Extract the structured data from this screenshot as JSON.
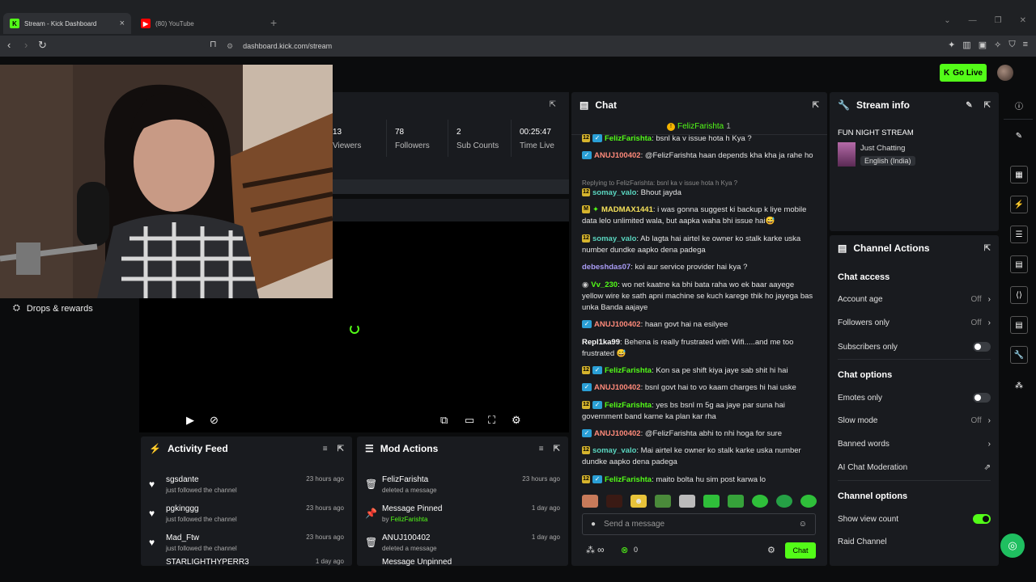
{
  "browser": {
    "tabs": [
      {
        "label": "Stream - Kick Dashboard",
        "active": true
      },
      {
        "label": "(80) YouTube",
        "active": false
      }
    ],
    "url": "dashboard.kick.com/stream"
  },
  "header": {
    "go_live": "Go Live"
  },
  "left_nav": {
    "drops": "Drops & rewards"
  },
  "stats": [
    {
      "value": "13",
      "label": "Viewers"
    },
    {
      "value": "78",
      "label": "Followers"
    },
    {
      "value": "2",
      "label": "Sub Counts"
    },
    {
      "value": "00:25:47",
      "label": "Time Live"
    }
  ],
  "activity_feed": {
    "title": "Activity Feed",
    "items": [
      {
        "name": "sgsdante",
        "sub": "just followed the channel",
        "time": "23 hours ago"
      },
      {
        "name": "pgkinggg",
        "sub": "just followed the channel",
        "time": "23 hours ago"
      },
      {
        "name": "Mad_Ftw",
        "sub": "just followed the channel",
        "time": "23 hours ago"
      },
      {
        "name": "STARLIGHTHYPERR3",
        "sub": "",
        "time": "1 day ago"
      }
    ]
  },
  "mod_actions": {
    "title": "Mod Actions",
    "items": [
      {
        "name": "FelizFarishta",
        "sub": "deleted a message",
        "by": "",
        "time": "23 hours ago"
      },
      {
        "name": "Message Pinned",
        "sub": "by ",
        "by": "FelizFarishta",
        "time": "1 day ago"
      },
      {
        "name": "ANUJ100402",
        "sub": "deleted a message",
        "by": "",
        "time": "1 day ago"
      },
      {
        "name": "Message Unpinned",
        "sub": "",
        "by": "",
        "time": ""
      }
    ]
  },
  "chat": {
    "title": "Chat",
    "pinned_user": "FelizFarishta",
    "pinned_count": "1",
    "messages": [
      {
        "user": "FelizFarishta",
        "color": "#53fc18",
        "text": ": bsnl ka v issue hota h Kya ?"
      },
      {
        "user": "ANUJ100402",
        "color": "#ff8a7a",
        "text": ": @FelizFarishta haan depends kha kha ja rahe ho"
      },
      {
        "user": "somay_valo",
        "color": "#5ad6c0",
        "text": ": Bhout jayda"
      },
      {
        "user": "MADMAX1441",
        "color": "#f5e15a",
        "text": ": i was gonna suggest ki backup k liye mobile data lelo unlimited wala, but aapka waha bhi issue hai😅"
      },
      {
        "user": "somay_valo",
        "color": "#5ad6c0",
        "text": ": Ab lagta hai airtel ke owner ko stalk karke uska number dundke aapko dena padega"
      },
      {
        "user": "debeshdas07",
        "color": "#a99cf5",
        "text": ": koi aur service provider hai kya ?"
      },
      {
        "user": "Vv_230",
        "color": "#53fc18",
        "text": ": wo net kaatne ka bhi bata raha wo ek baar aayege yellow wire ke sath apni machine se kuch karege thik ho jayega bas unka Banda aajaye"
      },
      {
        "user": "ANUJ100402",
        "color": "#ff8a7a",
        "text": ": haan govt hai na esilyee"
      },
      {
        "user": "Repl1ka99",
        "color": "#ffffff",
        "text": ": Behena is really frustrated with Wifi.....and me too frustrated 😅"
      },
      {
        "user": "FelizFarishta",
        "color": "#53fc18",
        "text": ": Kon sa pe shift kiya jaye sab shit hi hai"
      },
      {
        "user": "ANUJ100402",
        "color": "#ff8a7a",
        "text": ": bsnl govt hai to vo kaam charges hi hai uske"
      },
      {
        "user": "FelizFarishta",
        "color": "#53fc18",
        "text": ": yes bs bsnl m 5g aa jaye par suna hai government band karne ka plan kar rha"
      },
      {
        "user": "ANUJ100402",
        "color": "#ff8a7a",
        "text": ": @FelizFarishta abhi to nhi hoga for sure"
      },
      {
        "user": "somay_valo",
        "color": "#5ad6c0",
        "text": ": Mai airtel ke owner ko stalk karke uska number dundke aapko dena padega"
      },
      {
        "user": "FelizFarishta",
        "color": "#53fc18",
        "text": ": maito bolta hu sim post karwa lo"
      }
    ],
    "reply_note": "Replying to FelizFarishta: bsnl ka v issue hota h Kya ?",
    "placeholder": "Send a message",
    "viewers_symbol": "∞",
    "count": "0",
    "send": "Chat"
  },
  "stream_info": {
    "title": "Stream info",
    "stream_title": "FUN NIGHT STREAM",
    "category": "Just Chatting",
    "language": "English (India)"
  },
  "channel_actions": {
    "title": "Channel Actions",
    "chat_access": "Chat access",
    "account_age": {
      "label": "Account age",
      "value": "Off"
    },
    "followers_only": {
      "label": "Followers only",
      "value": "Off"
    },
    "subscribers_only": {
      "label": "Subscribers only",
      "on": false
    },
    "chat_options": "Chat options",
    "emotes_only": {
      "label": "Emotes only",
      "on": false
    },
    "slow_mode": {
      "label": "Slow mode",
      "value": "Off"
    },
    "banned_words": "Banned words",
    "ai_mod": "AI Chat Moderation",
    "channel_options": "Channel options",
    "show_view_count": {
      "label": "Show view count",
      "on": true
    },
    "raid_channel": "Raid Channel"
  }
}
